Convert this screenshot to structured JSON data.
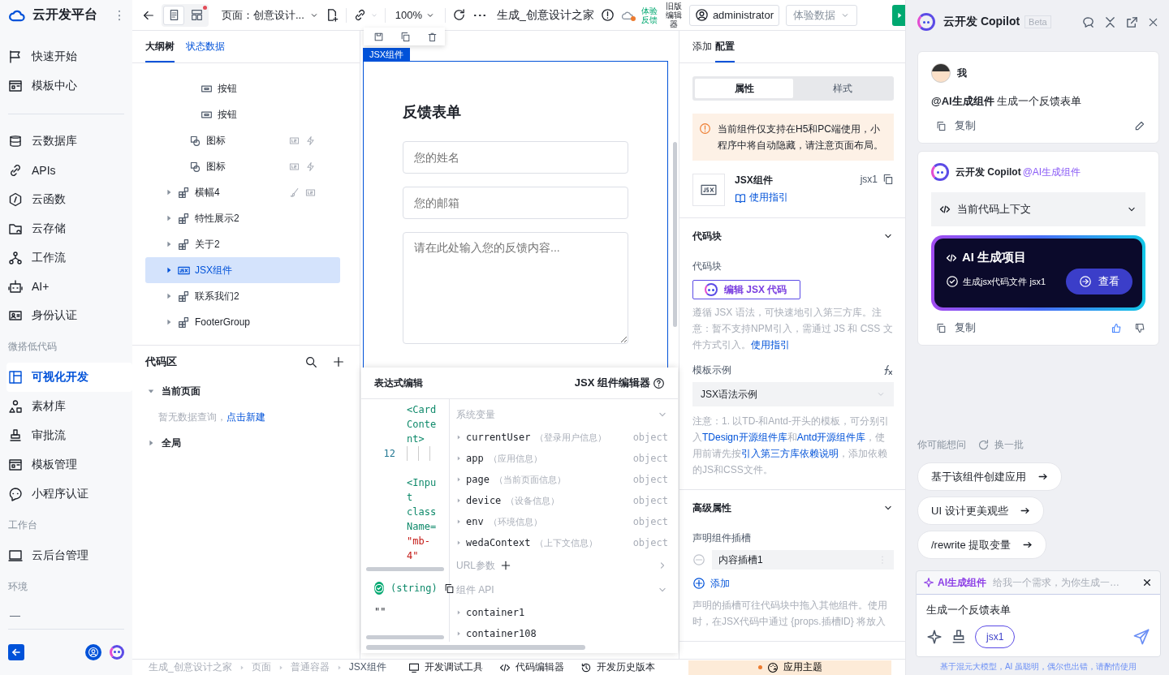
{
  "brand": {
    "name": "云开发平台"
  },
  "nav": {
    "groups": [
      {
        "items": [
          {
            "label": "快速开始",
            "selected": false
          },
          {
            "label": "模板中心",
            "selected": false
          }
        ]
      },
      {
        "items": [
          {
            "label": "云数据库",
            "selected": false
          },
          {
            "label": "APIs",
            "selected": false
          },
          {
            "label": "云函数",
            "selected": false
          },
          {
            "label": "云存储",
            "selected": false
          },
          {
            "label": "工作流",
            "selected": false
          },
          {
            "label": "AI+",
            "selected": false
          },
          {
            "label": "身份认证",
            "selected": false
          }
        ]
      },
      {
        "title": "微搭低代码",
        "items": [
          {
            "label": "可视化开发",
            "selected": true
          },
          {
            "label": "素材库",
            "selected": false
          },
          {
            "label": "审批流",
            "selected": false
          },
          {
            "label": "模板管理",
            "selected": false
          },
          {
            "label": "小程序认证",
            "selected": false
          }
        ]
      },
      {
        "title": "工作台",
        "items": [
          {
            "label": "云后台管理",
            "selected": false
          }
        ]
      },
      {
        "title": "环境",
        "value": "—"
      }
    ]
  },
  "toolbar": {
    "views": [
      {
        "selected": true,
        "notified": false
      },
      {
        "selected": false,
        "notified": true
      }
    ],
    "page_select": "页面：创意设计...",
    "zoom": "100%",
    "title": "生成_创意设计之家",
    "feedback": "体验反馈",
    "legacy_editor": "旧版编辑器",
    "user": "administrator",
    "data_select": "体验数据"
  },
  "tree_tabs": [
    {
      "label": "大纲树",
      "selected": true
    },
    {
      "label": "状态数据",
      "selected": false
    }
  ],
  "tree": [
    {
      "children": [
        {
          "children": [
            {
              "label": "按钮",
              "kind": "button",
              "selected": false
            },
            {
              "label": "按钮",
              "kind": "button",
              "selected": false
            }
          ]
        },
        {
          "label": "图标",
          "kind": "icon",
          "selected": false,
          "class_bound": true,
          "has_events": true
        },
        {
          "label": "图标",
          "kind": "icon",
          "selected": false,
          "class_bound": true,
          "has_events": true
        }
      ]
    },
    {
      "label": "横幅4",
      "kind": "group",
      "selected": false,
      "expanded": false,
      "styled": true,
      "class_bound": true
    },
    {
      "label": "特性展示2",
      "kind": "group",
      "selected": false,
      "expanded": false
    },
    {
      "label": "关于2",
      "kind": "group",
      "selected": false,
      "expanded": false
    },
    {
      "label": "JSX组件",
      "kind": "jsx",
      "selected": true,
      "expanded": false
    },
    {
      "label": "联系我们2",
      "kind": "group",
      "selected": false,
      "expanded": false
    },
    {
      "label": "FooterGroup",
      "kind": "group",
      "selected": false,
      "expanded": false
    }
  ],
  "code_area": {
    "title": "代码区",
    "sections": [
      {
        "label": "当前页面",
        "expanded": true,
        "empty": "暂无数据查询，",
        "action": "点击新建"
      },
      {
        "label": "全局",
        "expanded": false
      }
    ]
  },
  "canvas": {
    "component_label": "JSX组件",
    "form": {
      "title": "反馈表单",
      "fields": [
        {
          "kind": "input",
          "placeholder": "您的姓名"
        },
        {
          "kind": "input",
          "placeholder": "您的邮箱"
        },
        {
          "kind": "textarea",
          "placeholder": "请在此处输入您的反馈内容..."
        }
      ]
    }
  },
  "expression_editor": {
    "title": "表达式编辑",
    "editor_title": "JSX 组件编辑器",
    "code": [
      {
        "tokens": [
          {
            "kind": "tag",
            "text": "<CardContent>"
          }
        ]
      },
      {
        "number": "12"
      },
      {
        "tokens": [
          {
            "kind": "tag",
            "text": "<Input className="
          },
          {
            "kind": "string",
            "text": "\"mb-4\""
          }
        ]
      }
    ],
    "result": {
      "valid": true,
      "type": "(string)",
      "value": "\"\""
    },
    "groups": [
      {
        "title": "系统变量",
        "expanded": true,
        "addable": false,
        "items": [
          {
            "name": "currentUser",
            "desc": "（登录用户信息）",
            "type": "object"
          },
          {
            "name": "app",
            "desc": "（应用信息）",
            "type": "object"
          },
          {
            "name": "page",
            "desc": "（当前页面信息）",
            "type": "object"
          },
          {
            "name": "device",
            "desc": "（设备信息）",
            "type": "object"
          },
          {
            "name": "env",
            "desc": "（环境信息）",
            "type": "object"
          },
          {
            "name": "wedaContext",
            "desc": "（上下文信息）",
            "type": "object"
          }
        ]
      },
      {
        "title": "URL参数",
        "expanded": false,
        "addable": true
      },
      {
        "title": "组件 API",
        "expanded": true,
        "addable": false,
        "items": [
          {
            "name": "container1"
          },
          {
            "name": "container108"
          }
        ]
      }
    ]
  },
  "config": {
    "tabs": [
      {
        "label": "添加",
        "selected": false
      },
      {
        "label": "配置",
        "selected": true
      }
    ],
    "segments": [
      {
        "label": "属性",
        "selected": true
      },
      {
        "label": "样式",
        "selected": false
      }
    ],
    "warning": "当前组件仅支持在H5和PC端使用，小程序中将自动隐藏，请注意页面布局。",
    "component": {
      "name": "JSX组件",
      "guide": "使用指引",
      "id": "jsx1"
    },
    "code_block": {
      "title": "代码块",
      "expanded": true,
      "label": "代码块",
      "button": "编辑 JSX 代码",
      "description": [
        {
          "text": "遵循 JSX 语法，可快速地引入第三方库。注意：暂不支持NPM引入，需通过 JS 和 CSS 文件方式引入。"
        },
        {
          "text": "使用指引",
          "link": true
        }
      ],
      "template_label": "模板示例",
      "template_value": "JSX语法示例",
      "note": [
        {
          "text": "注意：1. 以TD-和Antd-开头的模板，可分别引入"
        },
        {
          "text": "TDesign开源组件库",
          "link": true
        },
        {
          "text": "和"
        },
        {
          "text": "Antd开源组件库",
          "link": true
        },
        {
          "text": "，使用前请先按"
        },
        {
          "text": "引入第三方库依赖说明",
          "link": true
        },
        {
          "text": "，添加依赖的JS和CSS文件。"
        }
      ]
    },
    "advanced": {
      "title": "高级属性",
      "expanded": true,
      "slot_label": "声明组件插槽",
      "slots": [
        "内容插槽1"
      ],
      "add": "添加",
      "description": "声明的插槽可往代码块中拖入其他组件。使用时，在JSX代码中通过 {props.插槽ID} 将放入"
    }
  },
  "copilot": {
    "title": "云开发 Copilot",
    "badge": "Beta",
    "messages": [
      {
        "kind": "user",
        "author": "我",
        "text": "**@AI生成组件** 生成一个反馈表单",
        "copy": "复制"
      },
      {
        "kind": "assistant",
        "author": "云开发 Copilot",
        "mention": "@AI生成组件",
        "context": "当前代码上下文",
        "project": {
          "title": "AI 生成项目",
          "status": "生成jsx代码文件 jsx1",
          "action": "查看"
        },
        "copy": "复制"
      }
    ],
    "suggest": {
      "title": "你可能想问",
      "refresh": "换一批",
      "items": [
        "基于该组件创建应用",
        "UI 设计更美观些",
        "/rewrite 提取变量"
      ]
    },
    "composer": {
      "mode": "AI生成组件",
      "hint": "给我一个需求，为你生成一…",
      "value": "生成一个反馈表单",
      "chip": "jsx1"
    },
    "disclaimer": "基于混元大模型，AI 虽聪明，偶尔也出错，请酌情使用"
  },
  "breadcrumb": [
    "生成_创意设计之家",
    "页面",
    "普通容器",
    "JSX组件"
  ],
  "dev_tools": [
    "开发调试工具",
    "代码编辑器",
    "开发历史版本"
  ],
  "theme_button": "应用主题"
}
